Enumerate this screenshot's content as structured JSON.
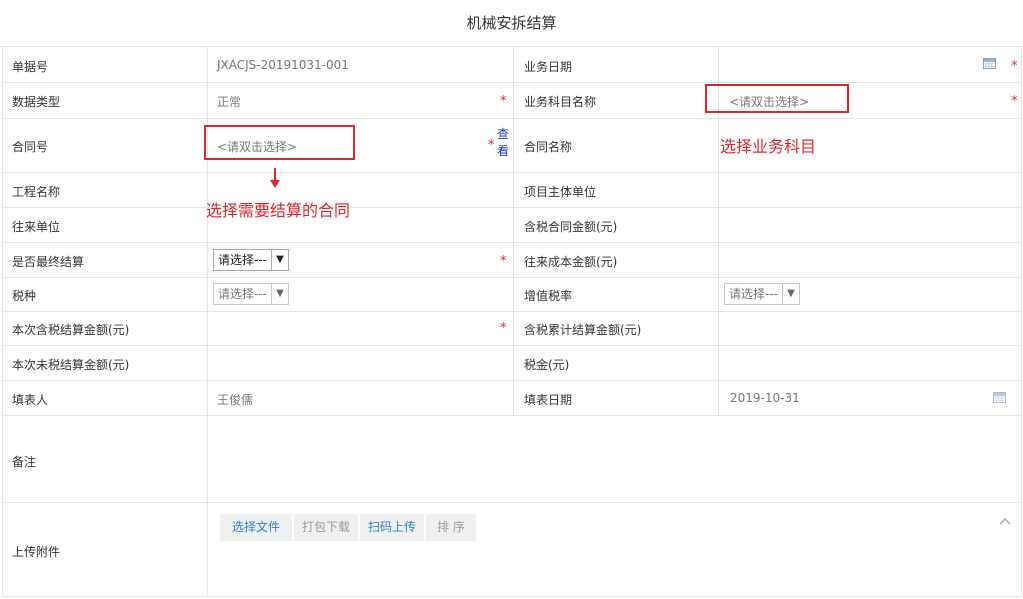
{
  "title": "机械安拆结算",
  "required_mark": "*",
  "fields": {
    "doc_no": {
      "label": "单据号",
      "value": "JXACJS-20191031-001"
    },
    "biz_date": {
      "label": "业务日期",
      "value": ""
    },
    "data_type": {
      "label": "数据类型",
      "value": "正常"
    },
    "subject_name": {
      "label": "业务科目名称",
      "placeholder": "<请双击选择>"
    },
    "contract_no": {
      "label": "合同号",
      "placeholder": "<请双击选择>",
      "view_link": "查看",
      "view_link_1": "查",
      "view_link_2": "看"
    },
    "contract_name": {
      "label": "合同名称",
      "value": ""
    },
    "project_name": {
      "label": "工程名称",
      "value": ""
    },
    "project_owner": {
      "label": "项目主体单位",
      "value": ""
    },
    "partner": {
      "label": "往来单位",
      "value": ""
    },
    "tax_contract_amount": {
      "label": "含税合同金额(元)",
      "value": ""
    },
    "is_final": {
      "label": "是否最终结算",
      "value": "请选择---"
    },
    "partner_cost": {
      "label": "往来成本金额(元)",
      "value": ""
    },
    "tax_type": {
      "label": "税种",
      "value": "请选择---"
    },
    "vat_rate": {
      "label": "增值税率",
      "value": "请选择---"
    },
    "this_tax_amount": {
      "label": "本次含税结算金额(元)",
      "value": ""
    },
    "cum_tax_amount": {
      "label": "含税累计结算金额(元)",
      "value": ""
    },
    "this_notax_amount": {
      "label": "本次未税结算金额(元)",
      "value": ""
    },
    "tax_amount": {
      "label": "税金(元)",
      "value": ""
    },
    "filler": {
      "label": "填表人",
      "value": "王俊儒"
    },
    "fill_date": {
      "label": "填表日期",
      "value": "2019-10-31"
    },
    "remark": {
      "label": "备注",
      "value": ""
    },
    "attachment": {
      "label": "上传附件"
    }
  },
  "attachment_buttons": {
    "select_file": "选择文件",
    "pack_download": "打包下载",
    "scan_upload": "扫码上传",
    "sort": "排 序"
  },
  "annotations": {
    "select_contract": "选择需要结算的合同",
    "select_subject": "选择业务科目"
  },
  "colors": {
    "required": "#e0262d",
    "annotation": "#e0262d",
    "link": "#1a3cb8",
    "button_active_text": "#2d7fd4",
    "button_disabled_text": "#999999",
    "border": "#e6e6e6"
  },
  "icons": [
    "calendar-icon",
    "select-arrow-icon",
    "collapse-chevron-icon",
    "annotation-arrow-icon"
  ]
}
